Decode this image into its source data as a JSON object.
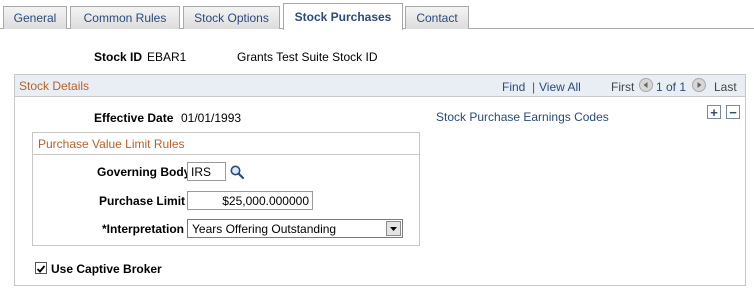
{
  "tabs": [
    {
      "label": "General",
      "active": false
    },
    {
      "label": "Common Rules",
      "active": false
    },
    {
      "label": "Stock Options",
      "active": false
    },
    {
      "label": "Stock Purchases",
      "active": true
    },
    {
      "label": "Contact",
      "active": false
    }
  ],
  "header": {
    "stock_id_label": "Stock ID",
    "stock_id_value": "EBAR1",
    "stock_description": "Grants Test Suite Stock ID"
  },
  "stock_details": {
    "title": "Stock Details",
    "nav": {
      "find": "Find",
      "separator": "|",
      "view_all": "View All",
      "first": "First",
      "range": "1 of 1",
      "last": "Last"
    },
    "effective_date_label": "Effective Date",
    "effective_date_value": "01/01/1993",
    "earnings_codes_link": "Stock Purchase Earnings Codes",
    "add_button": "+",
    "remove_button": "−",
    "purchase_value_limit": {
      "title": "Purchase Value Limit Rules",
      "governing_body_label": "Governing Body",
      "governing_body_value": "IRS",
      "purchase_limit_label": "Purchase Limit",
      "purchase_limit_value": "$25,000.000000",
      "interpretation_label": "*Interpretation",
      "interpretation_value": "Years Offering Outstanding"
    },
    "use_captive_broker_label": "Use Captive Broker",
    "use_captive_broker_checked": true
  },
  "colors": {
    "link": "#2b4a7c",
    "section_title": "#b5622b",
    "header_bg": "#e9eef4"
  }
}
